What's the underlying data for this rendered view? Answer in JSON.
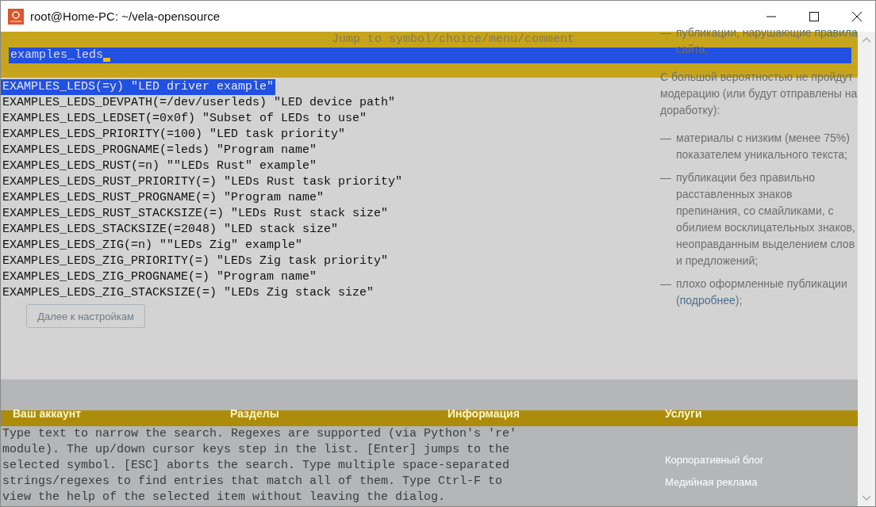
{
  "window": {
    "title": "root@Home-PC: ~/vela-opensource"
  },
  "dialog": {
    "title": "Jump to symbol/choice/menu/comment",
    "search": {
      "value": "examples_leds"
    }
  },
  "results": [
    {
      "text": "EXAMPLES_LEDS(=y) \"LED driver example\"",
      "selected": true
    },
    {
      "text": "EXAMPLES_LEDS_DEVPATH(=/dev/userleds) \"LED device path\"",
      "selected": false
    },
    {
      "text": "EXAMPLES_LEDS_LEDSET(=0x0f) \"Subset of LEDs to use\"",
      "selected": false
    },
    {
      "text": "EXAMPLES_LEDS_PRIORITY(=100) \"LED task priority\"",
      "selected": false
    },
    {
      "text": "EXAMPLES_LEDS_PROGNAME(=leds) \"Program name\"",
      "selected": false
    },
    {
      "text": "EXAMPLES_LEDS_RUST(=n) \"\"LEDs Rust\" example\"",
      "selected": false
    },
    {
      "text": "EXAMPLES_LEDS_RUST_PRIORITY(=) \"LEDs Rust task priority\"",
      "selected": false
    },
    {
      "text": "EXAMPLES_LEDS_RUST_PROGNAME(=) \"Program name\"",
      "selected": false
    },
    {
      "text": "EXAMPLES_LEDS_RUST_STACKSIZE(=) \"LEDs Rust stack size\"",
      "selected": false
    },
    {
      "text": "EXAMPLES_LEDS_STACKSIZE(=2048) \"LED stack size\"",
      "selected": false
    },
    {
      "text": "EXAMPLES_LEDS_ZIG(=n) \"\"LEDs Zig\" example\"",
      "selected": false
    },
    {
      "text": "EXAMPLES_LEDS_ZIG_PRIORITY(=) \"LEDs Zig task priority\"",
      "selected": false
    },
    {
      "text": "EXAMPLES_LEDS_ZIG_PROGNAME(=) \"Program name\"",
      "selected": false
    },
    {
      "text": "EXAMPLES_LEDS_ZIG_STACKSIZE(=) \"LEDs Zig stack size\"",
      "selected": false
    }
  ],
  "help_text": "Type text to narrow the search. Regexes are supported (via Python's 're' module). The up/down cursor keys step in the list. [Enter] jumps to the selected symbol. [ESC] aborts the search. Type multiple space-separated strings/regexes to find entries that match all of them. Type Ctrl-F to view the help of the selected item without leaving the dialog.",
  "background_page": {
    "rules": [
      {
        "marker": "—",
        "parts": [
          {
            "text": "публикации, нарушающие "
          },
          {
            "text": "правила",
            "kind": "link"
          },
          {
            "text": " сайта."
          }
        ]
      }
    ],
    "intro": "С большой вероятностью не пройдут модерацию (или будут отправлены на доработку):",
    "reasons": [
      {
        "marker": "—",
        "parts": [
          {
            "text": "материалы с низким (менее 75%) показателем уникального текста;"
          }
        ]
      },
      {
        "marker": "—",
        "parts": [
          {
            "text": "публикации без правильно расставленных знаков препинания, со смайликами, с обилием восклицательных знаков, неоправданным выделением слов и предложений;"
          }
        ]
      },
      {
        "marker": "—",
        "parts": [
          {
            "text": "плохо оформленные публикации ("
          },
          {
            "text": "подробнее",
            "kind": "link"
          },
          {
            "text": ");"
          }
        ]
      }
    ],
    "next_button": "Далее к настройкам",
    "footer": [
      {
        "heading": "Ваш аккаунт"
      },
      {
        "heading": "Разделы"
      },
      {
        "heading": "Информация"
      },
      {
        "heading": "Услуги",
        "links": [
          "Корпоративный блог",
          "Медийная реклама"
        ]
      }
    ]
  }
}
